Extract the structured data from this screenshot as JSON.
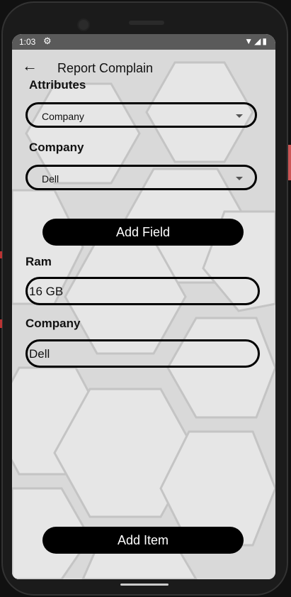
{
  "status_bar": {
    "time": "1:03",
    "settings_icon": "gear-icon",
    "icons": [
      "wifi-icon",
      "signal-icon",
      "battery-icon"
    ]
  },
  "app_bar": {
    "title": "Report Complain",
    "back_icon": "arrow-left-icon"
  },
  "form": {
    "attributes_label": "Attributes",
    "attributes_value": "Company",
    "company_label": "Company",
    "company_value": "Dell",
    "add_field_label": "Add Field"
  },
  "fields": {
    "ram_label": "Ram",
    "ram_value": "16 GB",
    "company_label": "Company",
    "company_value": "Dell"
  },
  "actions": {
    "add_item_label": "Add Item"
  },
  "colors": {
    "accent": "#000000",
    "background": "#dcdcdc",
    "status_bar": "#5a5a5a"
  }
}
